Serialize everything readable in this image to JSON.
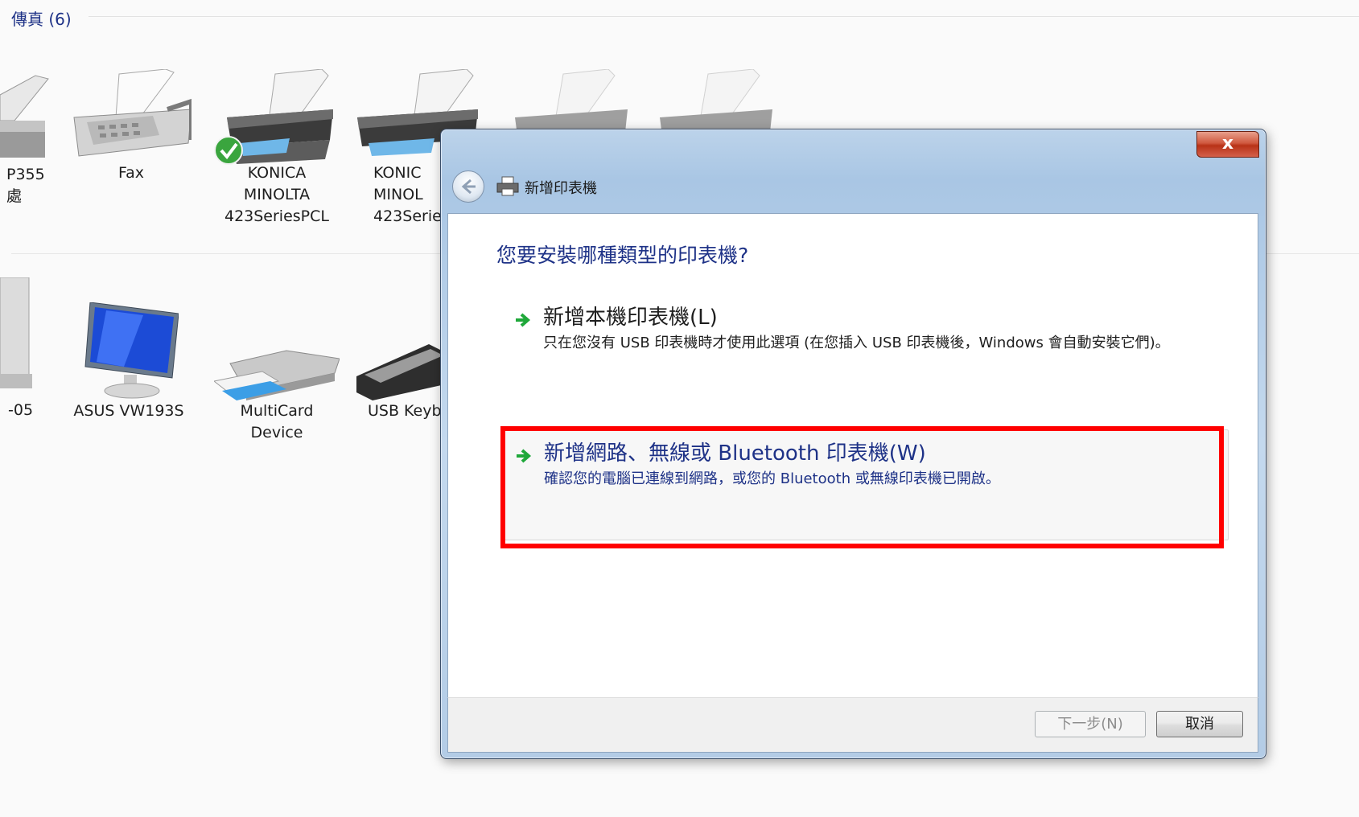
{
  "group": {
    "header": "傳真 (6)"
  },
  "devices_row1": [
    {
      "label_line1": "P355",
      "label_line2": "處",
      "label_line3": ""
    },
    {
      "label_line1": "Fax",
      "label_line2": "",
      "label_line3": ""
    },
    {
      "label_line1": "KONICA",
      "label_line2": "MINOLTA",
      "label_line3": "423SeriesPCL"
    },
    {
      "label_line1": "KONIC",
      "label_line2": "MINOL",
      "label_line3": "423Serie"
    }
  ],
  "devices_row2": [
    {
      "label_line1": "-05",
      "label_line2": ""
    },
    {
      "label_line1": "ASUS VW193S",
      "label_line2": ""
    },
    {
      "label_line1": "MultiCard",
      "label_line2": "Device"
    },
    {
      "label_line1": "USB Keyb",
      "label_line2": ""
    }
  ],
  "dialog": {
    "title": "新增印表機",
    "close_label": "x",
    "question": "您要安裝哪種類型的印表機?",
    "options": [
      {
        "title": "新增本機印表機(L)",
        "description": "只在您沒有 USB 印表機時才使用此選項 (在您插入 USB 印表機後，Windows 會自動安裝它們)。"
      },
      {
        "title": "新增網路、無線或 Bluetooth 印表機(W)",
        "description": "確認您的電腦已連線到網路，或您的 Bluetooth 或無線印表機已開啟。"
      }
    ],
    "buttons": {
      "next": "下一步(N)",
      "cancel": "取消"
    }
  },
  "colors": {
    "accent": "#1e3287",
    "highlight": "#ff0000",
    "arrow": "#1fa83a"
  }
}
